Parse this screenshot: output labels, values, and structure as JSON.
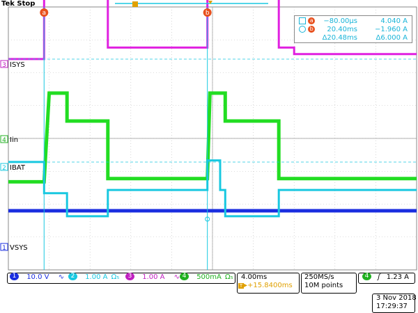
{
  "status": {
    "brand": "Tek",
    "state": "Stop"
  },
  "chart_data": {
    "type": "line",
    "x_range": [
      -40.0,
      40.0
    ],
    "x_unit": "ms",
    "grid_divisions": {
      "x": 10,
      "y": 8
    },
    "grid": true,
    "series": [
      {
        "channel": "3",
        "name": "ISYS",
        "color": "#e020e0",
        "points": [
          [
            -40.0,
            0.15
          ],
          [
            -33.0,
            0.15
          ],
          [
            -33.0,
            3.15
          ],
          [
            -20.5,
            3.15
          ],
          [
            -20.5,
            0.5
          ],
          [
            -1.0,
            0.5
          ],
          [
            -1.0,
            3.15
          ],
          [
            13.0,
            3.15
          ],
          [
            13.0,
            0.5
          ],
          [
            16.0,
            0.5
          ],
          [
            16.0,
            0.3
          ],
          [
            20.0,
            0.3
          ],
          [
            40.0,
            0.3
          ]
        ]
      },
      {
        "channel": "4",
        "name": "Iin",
        "color": "#22dd22",
        "points": [
          [
            -40.0,
            -1.3
          ],
          [
            -33.0,
            -1.3
          ],
          [
            -32.0,
            1.4
          ],
          [
            -28.5,
            1.4
          ],
          [
            -28.5,
            0.55
          ],
          [
            -20.5,
            0.55
          ],
          [
            -20.5,
            -1.2
          ],
          [
            -1.0,
            -1.2
          ],
          [
            -0.5,
            1.4
          ],
          [
            2.5,
            1.4
          ],
          [
            2.5,
            0.55
          ],
          [
            13.0,
            0.55
          ],
          [
            13.0,
            -1.2
          ],
          [
            40.0,
            -1.2
          ]
        ]
      },
      {
        "channel": "2",
        "name": "IBAT",
        "color": "#18c8e0",
        "points": [
          [
            -40.0,
            0.15
          ],
          [
            -33.0,
            0.15
          ],
          [
            -33.0,
            -0.8
          ],
          [
            -28.5,
            -0.8
          ],
          [
            -28.5,
            -1.5
          ],
          [
            -20.5,
            -1.5
          ],
          [
            -20.5,
            -0.7
          ],
          [
            -1.0,
            -0.7
          ],
          [
            -1.0,
            0.2
          ],
          [
            1.5,
            0.2
          ],
          [
            1.5,
            -0.7
          ],
          [
            2.5,
            -0.7
          ],
          [
            2.5,
            -1.5
          ],
          [
            13.0,
            -1.5
          ],
          [
            13.0,
            -0.7
          ],
          [
            40.0,
            -0.7
          ]
        ]
      },
      {
        "channel": "1",
        "name": "VSYS",
        "color": "#1a2ee0",
        "points": [
          [
            -40.0,
            1.1
          ],
          [
            40.0,
            1.1
          ]
        ]
      }
    ]
  },
  "labels": {
    "ch3": "ISYS",
    "ch4": "Iin",
    "ch2": "IBAT",
    "ch1": "VSYS",
    "cursor_a": "a",
    "cursor_b": "b"
  },
  "cursor_panel": {
    "a_time": "−80.00µs",
    "a_value": "4.040 A",
    "b_time": "20.40ms",
    "b_value": "−1.960 A",
    "delta_time": "Δ20.48ms",
    "delta_value": "Δ6.000 A"
  },
  "channels": [
    {
      "num": "1",
      "scale": "10.0 V",
      "color": "#1a2ee0"
    },
    {
      "num": "2",
      "scale": "1.00 A",
      "color": "#18c8e0",
      "suffix": "Ω₅"
    },
    {
      "num": "3",
      "scale": "1.00 A",
      "color": "#c020c0"
    },
    {
      "num": "4",
      "scale": "500mA",
      "color": "#20b020",
      "suffix": "Ω₅"
    }
  ],
  "timebase": {
    "scale": "4.00ms",
    "position": "▸+15.8400ms"
  },
  "acquisition": {
    "rate": "250MS/s",
    "points": "10M points"
  },
  "trigger": {
    "channel": "4",
    "level": "1.23 A"
  },
  "datetime": {
    "date": "3 Nov 2018",
    "time": "17:29:37"
  }
}
